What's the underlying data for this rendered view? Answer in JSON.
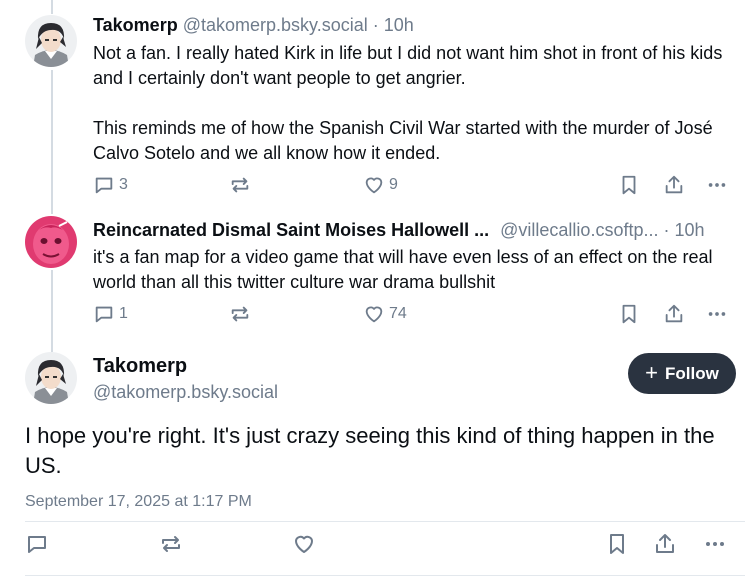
{
  "reply1": {
    "name": "Takomerp",
    "handle": "@takomerp.bsky.social",
    "dot": "·",
    "time": "10h",
    "paragraphs": [
      "Not a fan. I really hated Kirk in life but I did not want him shot in front of his kids and I certainly don't want people to get angrier.",
      "This reminds me of how the Spanish Civil War started with the murder of José Calvo Sotelo and we all know how it ended."
    ],
    "replies": "3",
    "likes": "9"
  },
  "reply2": {
    "name": "Reincarnated Dismal Saint Moises Hallowell ...",
    "handle": "@villecallio.csoftp...",
    "dot": "·",
    "time": "10h",
    "text": "it's a fan map for a video game that will have even less of an effect on the real world than all this twitter culture war drama bullshit",
    "replies": "1",
    "likes": "74"
  },
  "main": {
    "name": "Takomerp",
    "handle": "@takomerp.bsky.social",
    "follow_plus": "+",
    "follow_label": "Follow",
    "text": "I hope you're right. It's just crazy seeing this kind of thing happen in the US.",
    "date": "September 17, 2025 at 1:17 PM"
  },
  "icons": {
    "reply": "speech-bubble-icon",
    "repost": "repost-arrows-icon",
    "like": "heart-icon",
    "bookmark": "bookmark-icon",
    "share": "share-icon",
    "more": "ellipsis-icon"
  },
  "colors": {
    "muted": "#6e7b8b",
    "follow_bg": "#2a3340",
    "thread_line": "#d4dbe2"
  }
}
